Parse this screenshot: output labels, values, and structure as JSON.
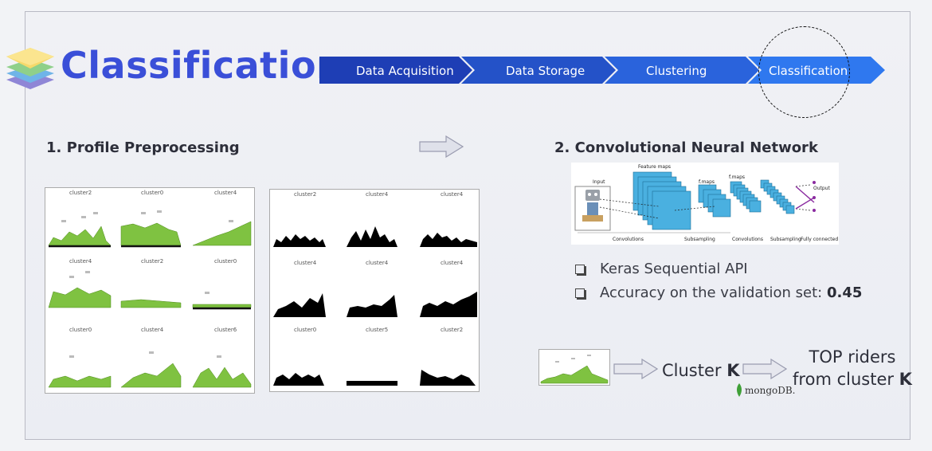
{
  "header": {
    "title": "Classification",
    "pipeline": [
      "Data Acquisition",
      "Data Storage",
      "Clustering",
      "Classification"
    ]
  },
  "left": {
    "heading": "1. Profile Preprocessing",
    "color_panel_labels": [
      "cluster2",
      "cluster0",
      "cluster4",
      "cluster4",
      "cluster2",
      "cluster0",
      "cluster0",
      "cluster4",
      "cluster6"
    ],
    "bw_panel_labels": [
      "cluster2",
      "cluster4",
      "cluster4",
      "cluster4",
      "cluster4",
      "cluster4",
      "cluster0",
      "cluster5",
      "cluster2"
    ]
  },
  "right": {
    "heading": "2. Convolutional Neural Network",
    "cnn_labels": {
      "input": "Input",
      "feature_maps": "Feature maps",
      "f_maps_1": "f.maps",
      "f_maps_2": "f.maps",
      "output": "Output",
      "convolutions_1": "Convolutions",
      "subsampling_1": "Subsampling",
      "convolutions_2": "Convolutions",
      "subsampling_2": "Subsampling",
      "fully_connected": "Fully connected"
    },
    "bullets": [
      {
        "text": "Keras Sequential API",
        "value": ""
      },
      {
        "text": "Accuracy on the validation set: ",
        "value": "0.45"
      }
    ],
    "flow": {
      "cluster_text": "Cluster ",
      "cluster_k": "K",
      "top_line1": "TOP riders",
      "top_line2": "from cluster ",
      "top_k": "K",
      "mongo": "mongoDB."
    }
  }
}
